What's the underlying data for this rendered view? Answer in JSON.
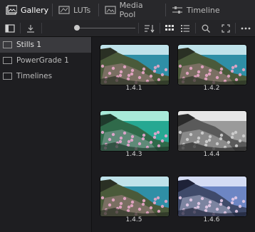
{
  "tabs": [
    {
      "label": "Gallery",
      "icon": "gallery-icon",
      "active": true
    },
    {
      "label": "LUTs",
      "icon": "luts-icon",
      "active": false
    },
    {
      "label": "Media Pool",
      "icon": "media-pool-icon",
      "active": false
    },
    {
      "label": "Timeline",
      "icon": "timeline-icon",
      "active": false
    }
  ],
  "sidebar": {
    "items": [
      {
        "label": "Stills 1",
        "selected": true
      },
      {
        "label": "PowerGrade 1",
        "selected": false
      },
      {
        "label": "Timelines",
        "selected": false
      }
    ]
  },
  "stills": [
    {
      "label": "1.4.1",
      "grade": "normal"
    },
    {
      "label": "1.4.2",
      "grade": "normal"
    },
    {
      "label": "1.4.3",
      "grade": "teal"
    },
    {
      "label": "1.4.4",
      "grade": "mono"
    },
    {
      "label": "1.4.5",
      "grade": "normal"
    },
    {
      "label": "1.4.6",
      "grade": "cool"
    }
  ],
  "colors": {
    "accent": "#ffffff",
    "selected_bg": "#3a3a3e"
  }
}
